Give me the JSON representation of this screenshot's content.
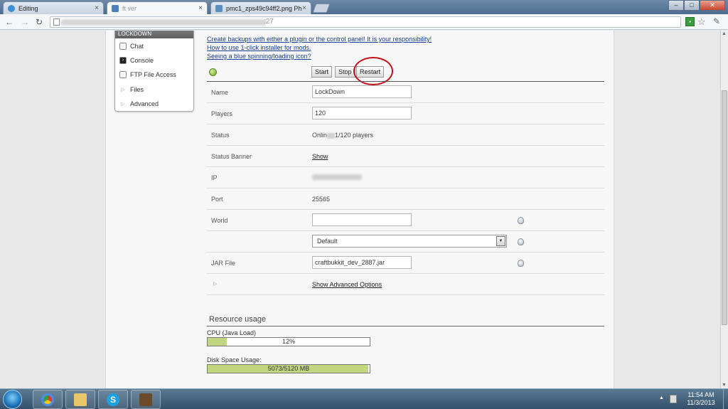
{
  "browser": {
    "tabs": [
      {
        "title": "Editing",
        "favicon_color": "#3d8fd1"
      },
      {
        "title": "ft       ver",
        "favicon_color": "#4b7fbf"
      },
      {
        "title": "pmc1_zps49c94ff2.png Ph",
        "favicon_color": "#5b8ec0"
      }
    ],
    "tab_close_glyph": "×",
    "window_buttons": {
      "minimize": "–",
      "maximize": "□",
      "close": "✕"
    },
    "nav": {
      "back": "←",
      "forward": "→",
      "reload": "↻"
    },
    "url_tail": ":27",
    "icons": {
      "extension": "extension-icon",
      "bookmark": "star-icon",
      "menu": "wrench-icon"
    }
  },
  "sidebar": {
    "header": "LOCKDOWN",
    "items": [
      {
        "label": "Chat",
        "icon": "chat-icon"
      },
      {
        "label": "Console",
        "icon": "console-icon"
      },
      {
        "label": "FTP File Access",
        "icon": "ftp-icon"
      },
      {
        "label": "Files",
        "icon": "expand-arrow-icon"
      },
      {
        "label": "Advanced",
        "icon": "expand-arrow-icon"
      }
    ]
  },
  "notices": [
    "Create backups with either a plugin or the control panel! It is your responsibility!",
    "How to use 1-click installer for mods.",
    "Seeing a blue spinning/loading icon?"
  ],
  "controls": {
    "start": "Start",
    "stop": "Stop",
    "restart": "Restart",
    "status_color": "#6aa81c",
    "highlight_color": "#c8101d"
  },
  "server": {
    "name_label": "Name",
    "name_value": "LockDown",
    "players_label": "Players",
    "players_value": "120",
    "status_label": "Status",
    "status_prefix": "Onlin",
    "status_suffix": "1/120 players",
    "banner_label": "Status Banner",
    "banner_link": "Show",
    "ip_label": "IP",
    "port_label": "Port",
    "port_value": "25565",
    "world_label": "World",
    "world_value": "",
    "world_select": "Default",
    "jar_label": "JAR File",
    "jar_value": "craftbukkit_dev_2887.jar",
    "advanced_link": "Show Advanced Options"
  },
  "resources": {
    "title": "Resource usage",
    "cpu_label": "CPU (Java Load)",
    "cpu_text": "12%",
    "cpu_percent": 12,
    "disk_label": "Disk Space Usage:",
    "disk_text": "5073/5120 MB",
    "disk_percent": 99,
    "bar_color": "#c1d67f"
  },
  "taskbar": {
    "time": "11:54 AM",
    "date": "11/3/2013",
    "apps": [
      "chrome-icon",
      "file-explorer-icon",
      "skype-icon",
      "minecraft-icon"
    ]
  }
}
